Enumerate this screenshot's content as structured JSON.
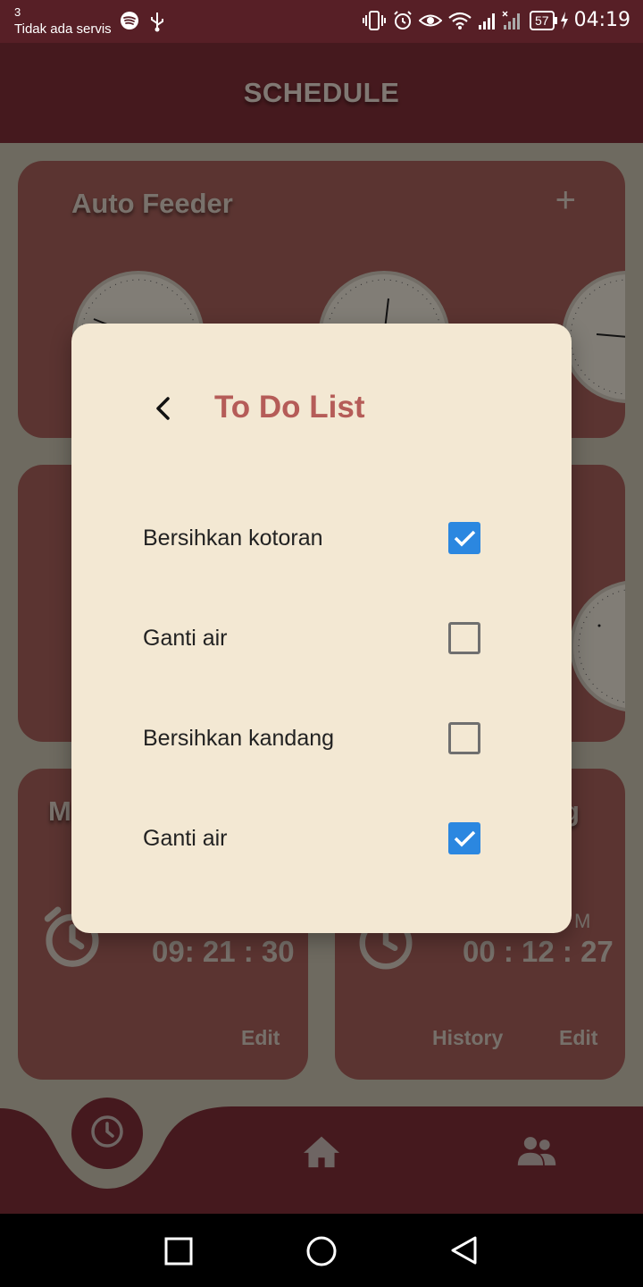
{
  "status_bar": {
    "sim_slot": "3",
    "carrier": "Tidak ada servis",
    "battery": "57",
    "time": "04:19"
  },
  "app_bar": {
    "title": "SCHEDULE"
  },
  "cards": {
    "auto_feeder": {
      "title": "Auto Feeder",
      "add_icon": "plus-icon"
    },
    "bottom_left": {
      "title_partial": "M",
      "time": "09: 21 : 30",
      "edit": "Edit"
    },
    "bottom_right": {
      "title_partial": "g",
      "am_label": "M",
      "time": "00 : 12 : 27",
      "history": "History",
      "edit": "Edit"
    }
  },
  "bottom_nav": [
    {
      "icon": "clock-icon",
      "active": true
    },
    {
      "icon": "home-icon",
      "active": false
    },
    {
      "icon": "people-icon",
      "active": false
    }
  ],
  "dialog": {
    "title": "To Do List",
    "back_icon": "chevron-left-icon",
    "items": [
      {
        "label": "Bersihkan kotoran",
        "checked": true
      },
      {
        "label": "Ganti air",
        "checked": false
      },
      {
        "label": "Bersihkan kandang",
        "checked": false
      },
      {
        "label": "Ganti air",
        "checked": true
      }
    ]
  },
  "colors": {
    "primary": "#7f2f37",
    "card": "#a6605a",
    "dialog_bg": "#f3e8d3",
    "dialog_title": "#b55c58",
    "checkbox_checked": "#2b87e0"
  }
}
